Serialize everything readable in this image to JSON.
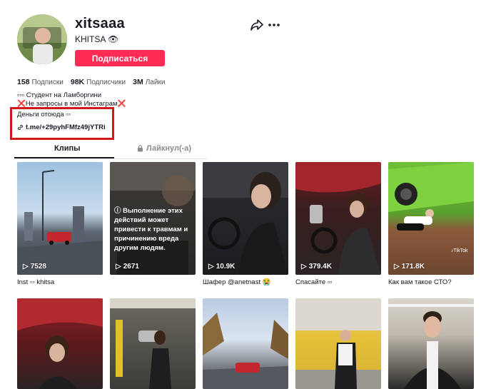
{
  "profile": {
    "username": "xitsaaa",
    "nickname": "KHITSA 👁",
    "follow_label": "Подписаться",
    "stats": [
      {
        "value": "158",
        "label": "Подписки"
      },
      {
        "value": "98K",
        "label": "Подписчики"
      },
      {
        "value": "3M",
        "label": "Лайки"
      }
    ],
    "bio": [
      "▫▫▫ Студент на Ламборгини",
      "❌Не запросы в мой Инстаграм❌",
      "Деньги отоюда ▫▫"
    ],
    "link": "t.me/+29pyhFMfz49jYTRi"
  },
  "tabs": {
    "clips": "Клипы",
    "liked": "Лайкнул(-а)"
  },
  "videos": [
    {
      "views": "7528",
      "caption": "Inst ▫▫ khitsa"
    },
    {
      "views": "2671",
      "caption": "",
      "warning": "Выполнение этих действий может привести к травмам и причинению вреда другим людям."
    },
    {
      "views": "10.9K",
      "caption": "Шафер @anetnast 😭"
    },
    {
      "views": "379.4K",
      "caption": "Спасайте ▫▫"
    },
    {
      "views": "171.8K",
      "caption": "Как вам такое СТО?"
    }
  ],
  "colors": {
    "follow": "#fe2c55",
    "highlight": "#d0191b"
  }
}
